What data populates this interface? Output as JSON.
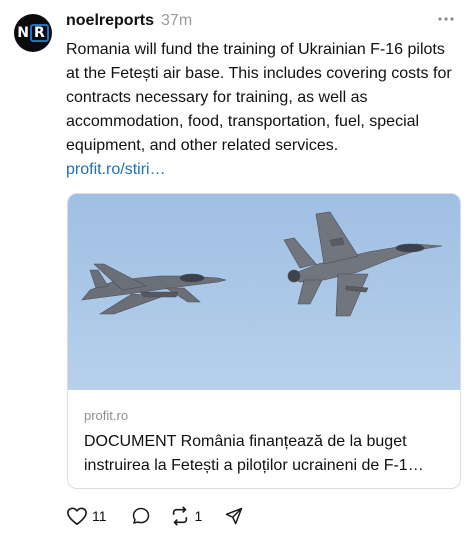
{
  "post": {
    "avatar_initials": {
      "first": "N",
      "second": "R"
    },
    "username": "noelreports",
    "time": "37m",
    "text": "Romania will fund the training of Ukrainian F-16 pilots at the Fetești air base. This includes covering costs for contracts necessary for training, as well as accommodation, food, transportation, fuel, special equipment, and other related services.",
    "link": "profit.ro/stiri…"
  },
  "card": {
    "image_icon": "fighter-jets-photo",
    "domain": "profit.ro",
    "title": "DOCUMENT România finanțează de la buget instruirea la Fetești a piloților ucraineni de F-1…"
  },
  "actions": {
    "likes": "11",
    "reposts": "1"
  },
  "icons": {
    "more": "more-horizontal-icon",
    "like": "heart-icon",
    "reply": "comment-icon",
    "repost": "repost-icon",
    "share": "send-icon"
  },
  "colors": {
    "link": "#1f6fb8",
    "sky": "#a9c6e6",
    "avatar_ring": "#1a73c9"
  }
}
